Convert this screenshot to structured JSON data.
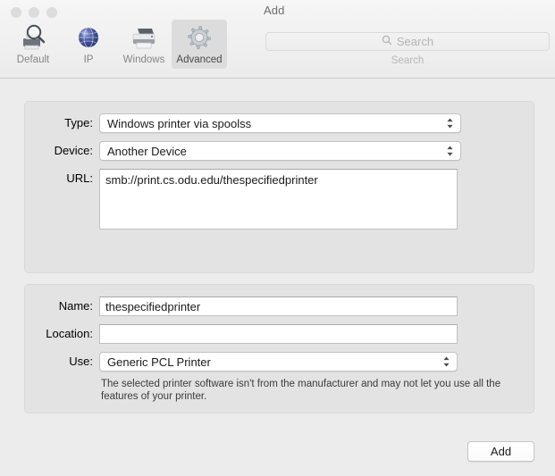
{
  "window": {
    "title": "Add",
    "traffic_lights": [
      "close",
      "minimize",
      "zoom"
    ]
  },
  "toolbar": {
    "tabs": [
      {
        "id": "default",
        "label": "Default",
        "icon": "printer-magnifier-icon",
        "selected": false
      },
      {
        "id": "ip",
        "label": "IP",
        "icon": "globe-icon",
        "selected": false
      },
      {
        "id": "windows",
        "label": "Windows",
        "icon": "printer-icon",
        "selected": false
      },
      {
        "id": "advanced",
        "label": "Advanced",
        "icon": "gear-icon",
        "selected": true
      }
    ],
    "search": {
      "placeholder": "Search",
      "value": "",
      "caption": "Search",
      "icon": "search-icon"
    }
  },
  "form": {
    "type": {
      "label": "Type:",
      "value": "Windows printer via spoolss"
    },
    "device": {
      "label": "Device:",
      "value": "Another Device"
    },
    "url": {
      "label": "URL:",
      "value": "smb://print.cs.odu.edu/thespecifiedprinter"
    },
    "name": {
      "label": "Name:",
      "value": "thespecifiedprinter"
    },
    "location": {
      "label": "Location:",
      "value": ""
    },
    "use": {
      "label": "Use:",
      "value": "Generic PCL Printer"
    },
    "hint": "The selected printer software isn't from the manufacturer and may not let you use all the features of your printer."
  },
  "footer": {
    "add_label": "Add"
  },
  "colors": {
    "window_background": "#ececec",
    "panel_background": "#e3e3e3",
    "field_background": "#ffffff",
    "title_text": "#6e6e6e",
    "selected_tab_background": "#dcdcdc"
  }
}
